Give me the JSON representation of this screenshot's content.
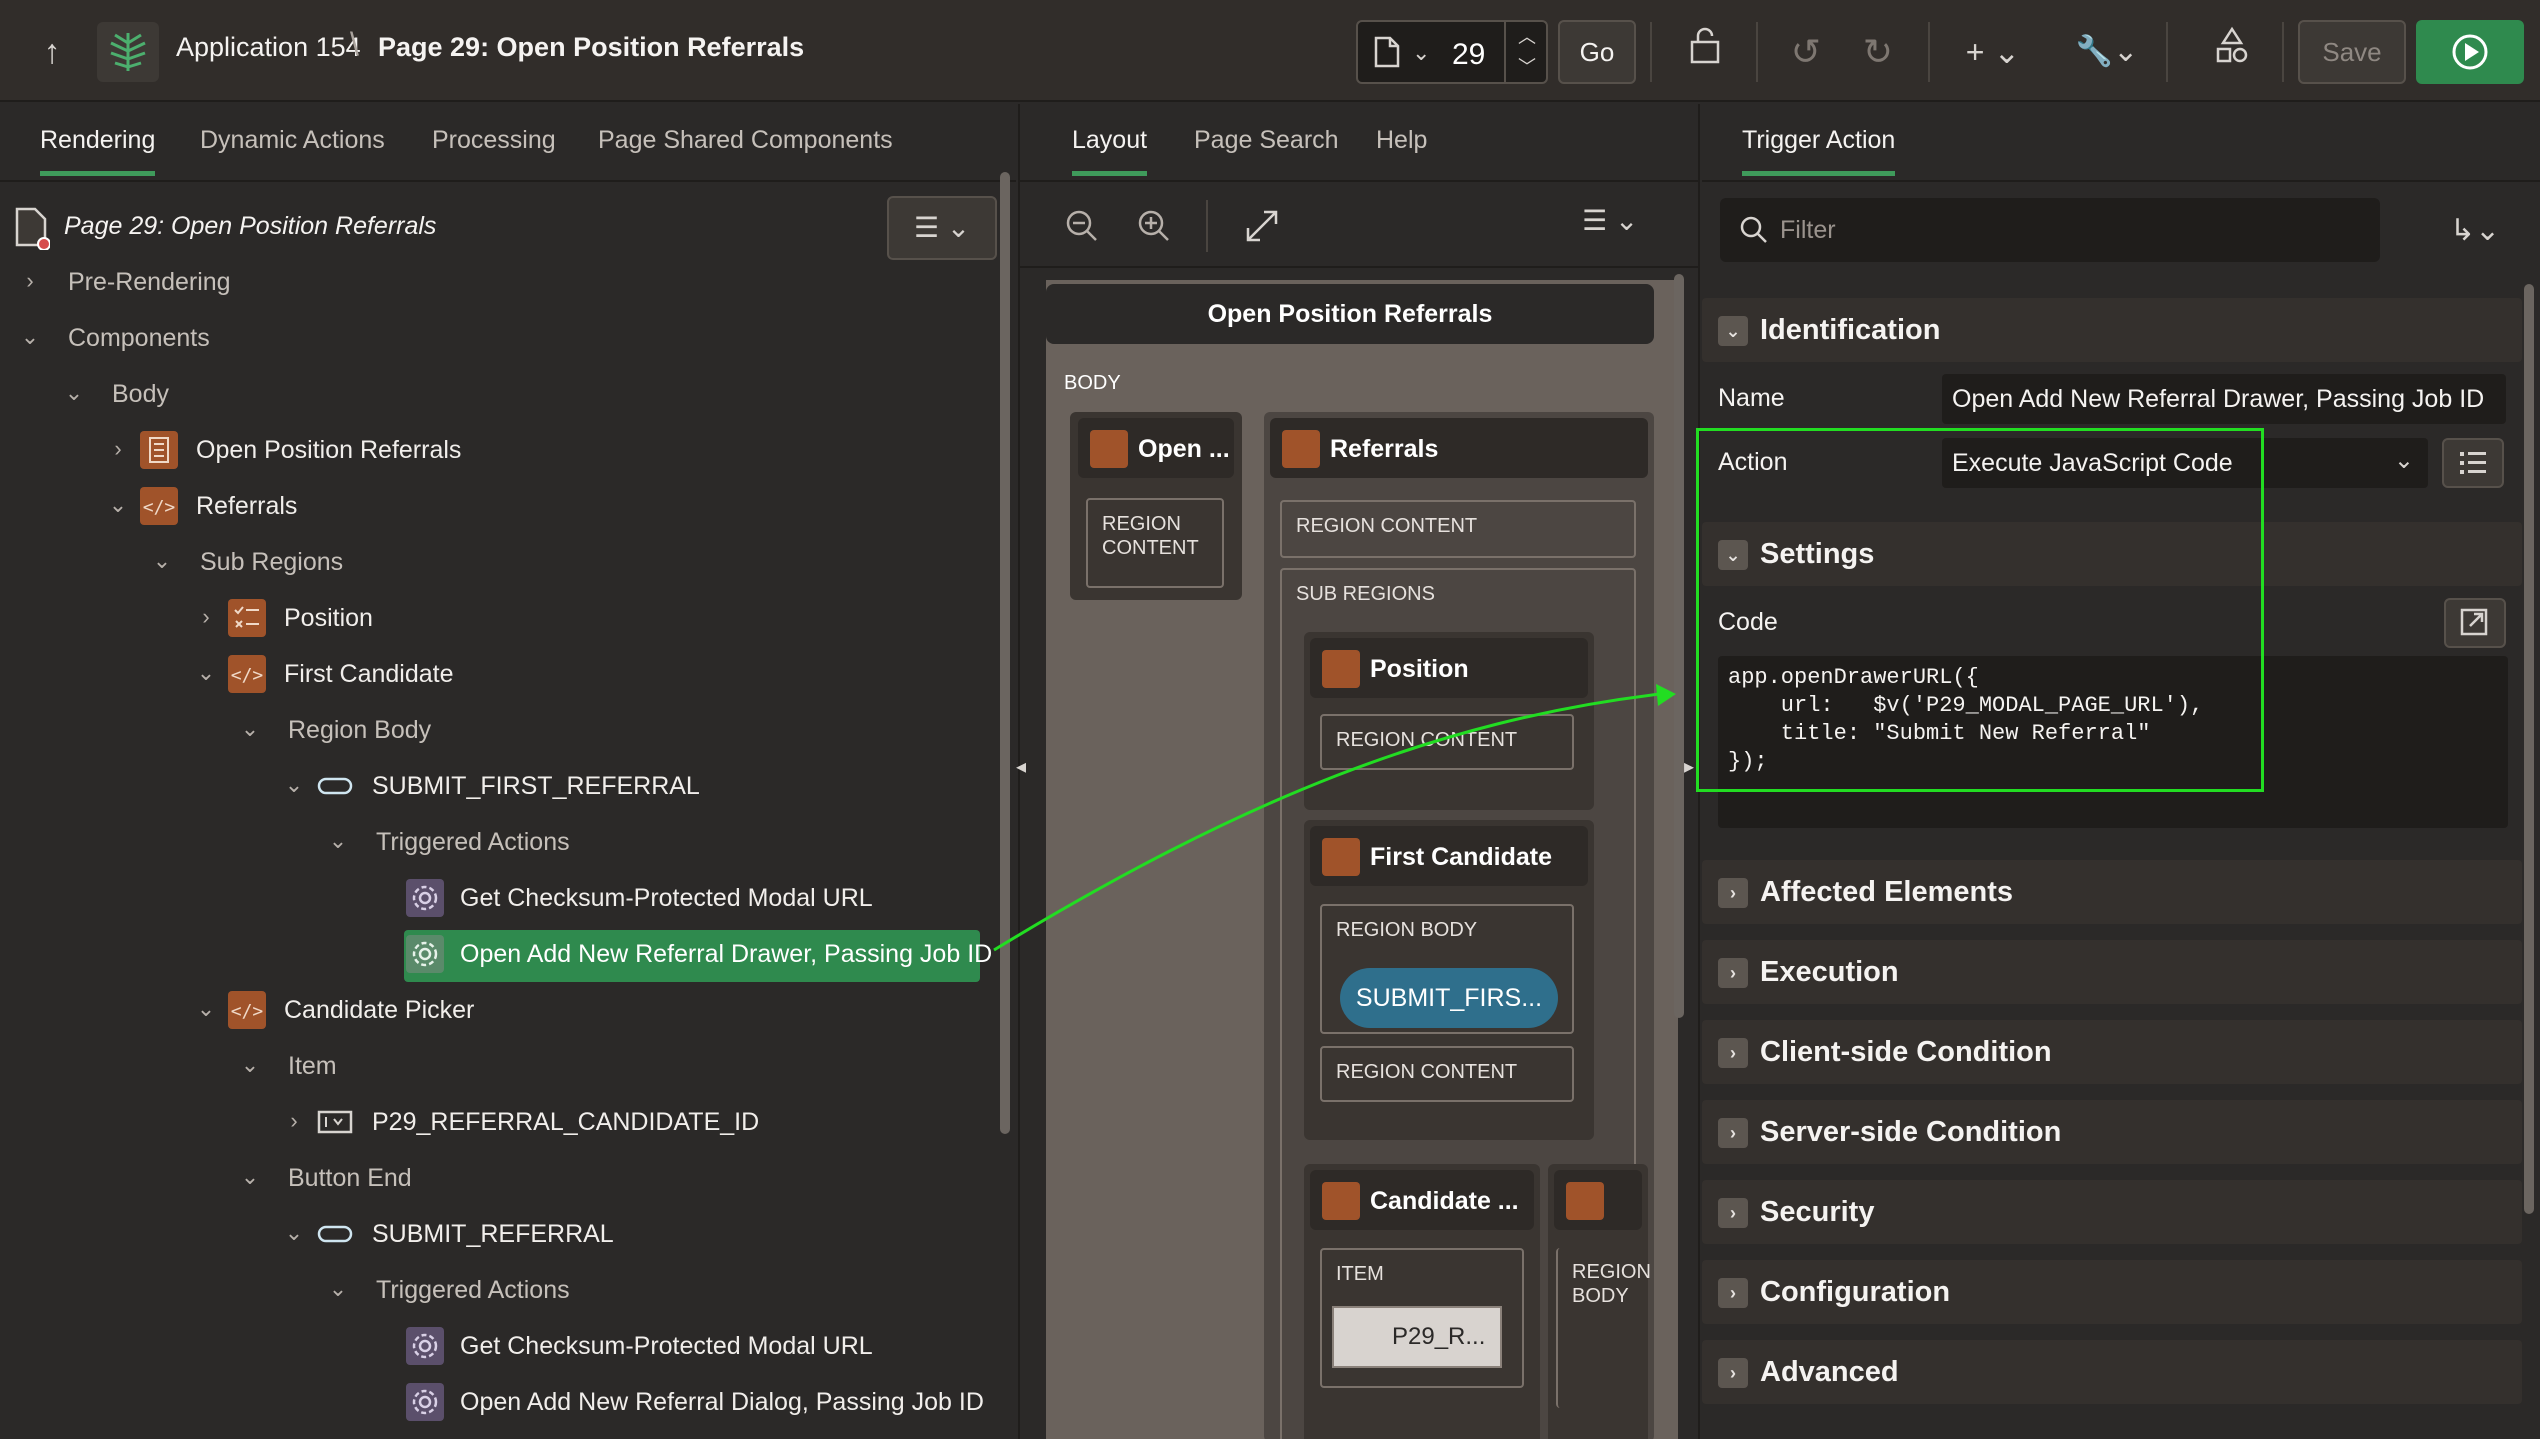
{
  "header": {
    "app": "Application 154",
    "separator": "\\",
    "page": "Page 29: Open Position Referrals",
    "page_number": "29",
    "go": "Go",
    "save": "Save"
  },
  "left": {
    "tabs": [
      "Rendering",
      "Dynamic Actions",
      "Processing",
      "Page Shared Components"
    ],
    "root": "Page 29: Open Position Referrals",
    "tree": [
      {
        "label": "Pre-Rendering"
      },
      {
        "label": "Components"
      },
      {
        "label": "Body"
      },
      {
        "label": "Open Position Referrals"
      },
      {
        "label": "Referrals"
      },
      {
        "label": "Sub Regions"
      },
      {
        "label": "Position"
      },
      {
        "label": "First Candidate"
      },
      {
        "label": "Region Body"
      },
      {
        "label": "SUBMIT_FIRST_REFERRAL"
      },
      {
        "label": "Triggered Actions"
      },
      {
        "label": "Get Checksum-Protected Modal URL"
      },
      {
        "label": "Open Add New Referral Drawer, Passing Job ID"
      },
      {
        "label": "Candidate Picker"
      },
      {
        "label": "Item"
      },
      {
        "label": "P29_REFERRAL_CANDIDATE_ID"
      },
      {
        "label": "Button End"
      },
      {
        "label": "SUBMIT_REFERRAL"
      },
      {
        "label": "Triggered Actions"
      },
      {
        "label": "Get Checksum-Protected Modal URL"
      },
      {
        "label": "Open Add New Referral Dialog, Passing Job ID"
      }
    ]
  },
  "mid": {
    "tabs": [
      "Layout",
      "Page Search",
      "Help"
    ],
    "region_title": "Open Position Referrals",
    "body": "BODY",
    "open_short": "Open ...",
    "referrals": "Referrals",
    "region_content": "REGION CONTENT",
    "region_content_split": [
      "REGION",
      "CONTENT"
    ],
    "sub_regions": "SUB REGIONS",
    "position": "Position",
    "first_candidate": "First Candidate",
    "region_body": "REGION BODY",
    "region_body_split": [
      "REGION",
      "BODY"
    ],
    "submit_first": "SUBMIT_FIRS...",
    "candidate_short": "Candidate ...",
    "item": "ITEM",
    "p29_short": "P29_R..."
  },
  "right": {
    "tab": "Trigger Action",
    "filter_placeholder": "Filter",
    "sections": {
      "identification": "Identification",
      "settings": "Settings",
      "affected": "Affected Elements",
      "execution": "Execution",
      "client": "Client-side Condition",
      "server": "Server-side Condition",
      "security": "Security",
      "configuration": "Configuration",
      "advanced": "Advanced"
    },
    "name_label": "Name",
    "name_value": "Open Add New Referral Drawer, Passing Job ID",
    "action_label": "Action",
    "action_value": "Execute JavaScript Code",
    "code_label": "Code",
    "code": "app.openDrawerURL({\n    url:   $v('P29_MODAL_PAGE_URL'),\n    title: \"Submit New Referral\"\n});"
  },
  "colors": {
    "accent": "#3f9b5b",
    "highlight": "#22dd22",
    "component": "#a0532a"
  }
}
